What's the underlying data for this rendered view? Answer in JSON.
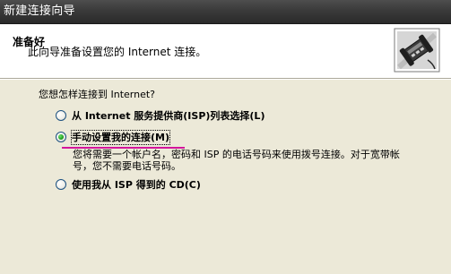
{
  "window": {
    "title": "新建连接向导"
  },
  "header": {
    "title": "准备好",
    "subtitle": "此向导准备设置您的 Internet 连接。",
    "icon": "phone-modem-icon"
  },
  "content": {
    "question": "您想怎样连接到 Internet?",
    "options": [
      {
        "label": "从 Internet 服务提供商(ISP)列表选择(L)",
        "checked": false
      },
      {
        "label": "手动设置我的连接(M)",
        "checked": true
      },
      {
        "label": "使用我从 ISP 得到的 CD(C)",
        "checked": false
      }
    ],
    "manual_description": "您将需要一个帐户名，密码和 ISP 的电话号码来使用拨号连接。对于宽带帐号，您不需要电话号码。"
  },
  "colors": {
    "title_bar": "#3a3a3a",
    "dialog_bg": "#ece9d8",
    "annotation_underline": "#d4159c",
    "radio_selected": "#21a121"
  }
}
